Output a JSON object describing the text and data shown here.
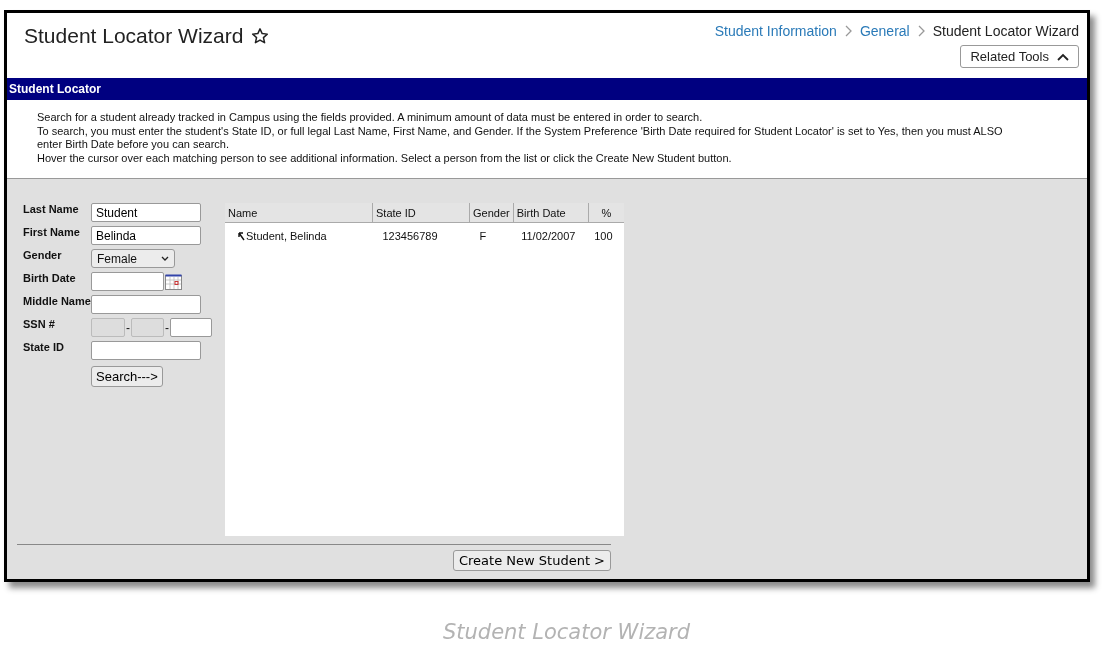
{
  "header": {
    "title": "Student Locator Wizard",
    "favorite": false,
    "breadcrumbs": [
      {
        "label": "Student Information",
        "link": true
      },
      {
        "label": "General",
        "link": true
      },
      {
        "label": "Student Locator Wizard",
        "link": false
      }
    ],
    "related_tools": {
      "label": "Related Tools",
      "expanded": true
    }
  },
  "section": {
    "title": "Student Locator"
  },
  "instructions": [
    "Search for a student already tracked in Campus using the fields provided. A minimum amount of data must be entered in order to search.",
    "To search, you must enter the student's State ID, or full legal Last Name, First Name, and Gender. If the System Preference 'Birth Date required for Student Locator' is set to Yes, then you must ALSO enter Birth Date before you can search.",
    "Hover the cursor over each matching person to see additional information. Select a person from the list or click the Create New Student button."
  ],
  "form": {
    "fields": [
      {
        "kind": "text",
        "label": "Last Name",
        "value": "Student"
      },
      {
        "kind": "text",
        "label": "First Name",
        "value": "Belinda"
      },
      {
        "kind": "select",
        "label": "Gender",
        "value": "Female"
      },
      {
        "kind": "date",
        "label": "Birth Date"
      },
      {
        "kind": "text",
        "label": "Middle Name"
      },
      {
        "kind": "ssn",
        "label": "SSN #",
        "parts": [
          {
            "disabled": true
          },
          {
            "disabled": true
          },
          {
            "disabled": false
          }
        ],
        "separators": [
          "-",
          "-"
        ]
      },
      {
        "kind": "text",
        "label": "State ID"
      }
    ],
    "search_button": "Search--->"
  },
  "results": {
    "columns": [
      "Name",
      "State ID",
      "Gender",
      "Birth Date",
      "%"
    ],
    "rows": [
      {
        "cells": [
          "Student, Belinda",
          "123456789",
          "F",
          "11/02/2007",
          "100"
        ]
      }
    ]
  },
  "create_button": "Create New Student >",
  "caption": "Student Locator Wizard"
}
